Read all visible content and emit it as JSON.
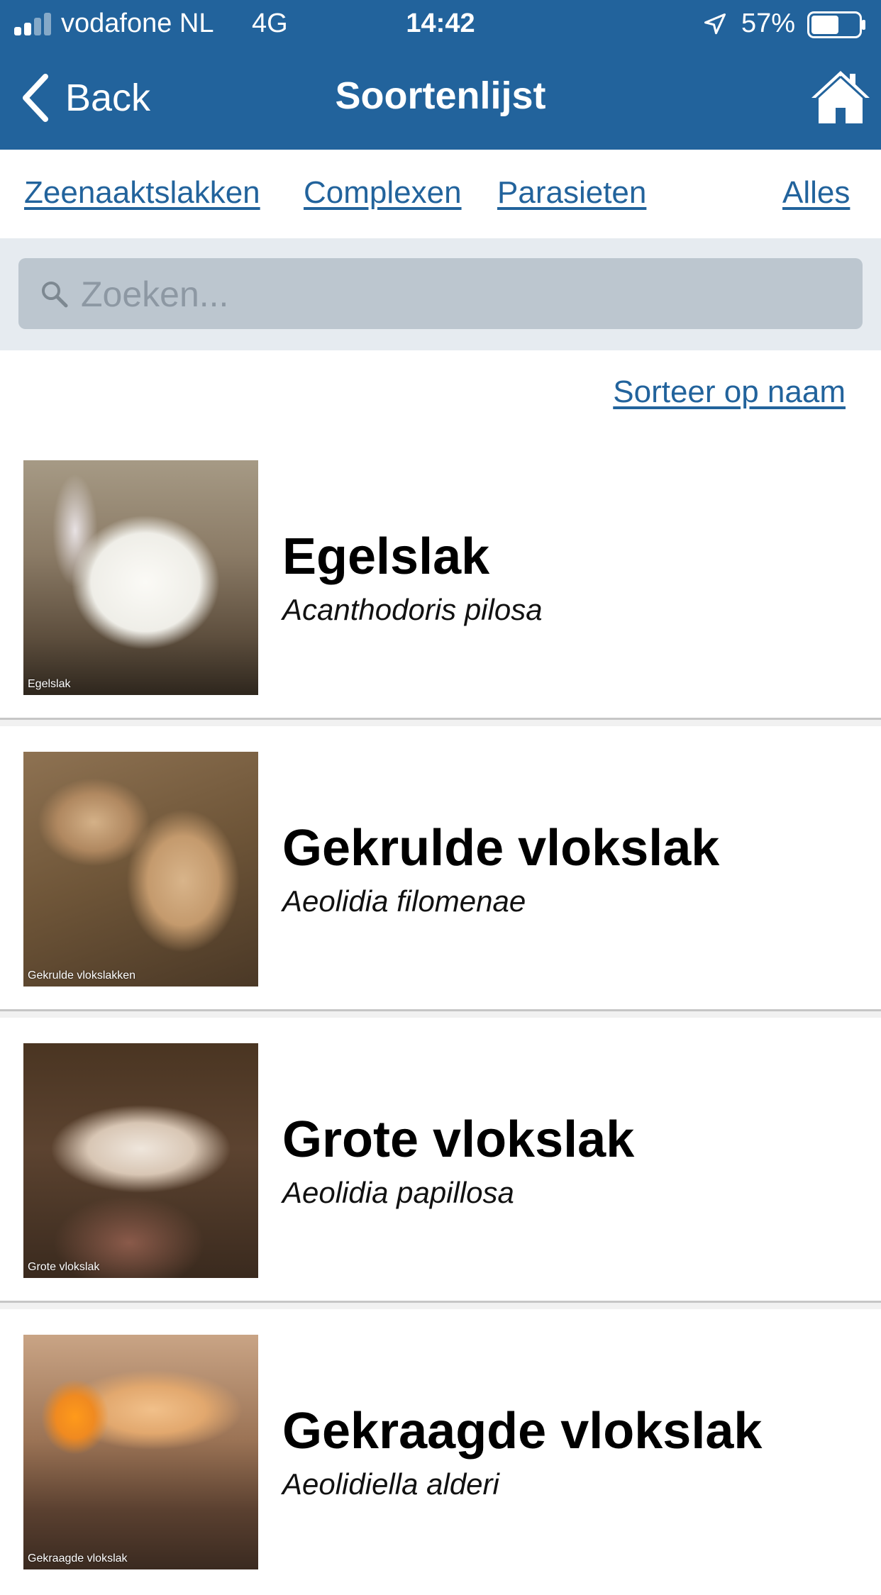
{
  "status": {
    "carrier": "vodafone NL",
    "network": "4G",
    "time": "14:42",
    "battery": "57%",
    "battery_level": 0.57,
    "icons": [
      "signal-icon",
      "location-icon",
      "battery-icon"
    ]
  },
  "nav": {
    "back_label": "Back",
    "title": "Soortenlijst",
    "home_icon": "home-icon"
  },
  "filters": {
    "zeenaaktslakken": "Zeenaaktslakken",
    "complexen": "Complexen",
    "parasieten": "Parasieten",
    "alles": "Alles"
  },
  "search": {
    "placeholder": "Zoeken...",
    "icon": "search-icon"
  },
  "sort_label": "Sorteer op naam",
  "colors": {
    "primary": "#22639c",
    "search_bg": "#e6ebf0",
    "search_field": "#bcc6cf"
  },
  "species": [
    {
      "name": "Egelslak",
      "latin": "Acanthodoris pilosa",
      "caption": "Egelslak"
    },
    {
      "name": "Gekrulde vlokslak",
      "latin": "Aeolidia filomenae",
      "caption": "Gekrulde vlokslakken"
    },
    {
      "name": "Grote vlokslak",
      "latin": "Aeolidia papillosa",
      "caption": "Grote vlokslak"
    },
    {
      "name": "Gekraagde vlokslak",
      "latin": "Aeolidiella alderi",
      "caption": "Gekraagde vlokslak"
    }
  ]
}
